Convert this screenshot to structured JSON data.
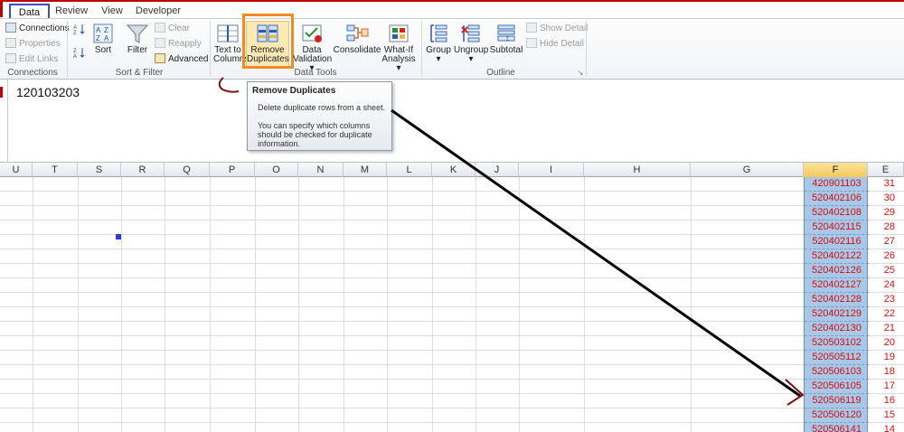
{
  "tabs": [
    {
      "label": "Data",
      "active": true
    },
    {
      "label": "Review",
      "active": false
    },
    {
      "label": "View",
      "active": false
    },
    {
      "label": "Developer",
      "active": false
    }
  ],
  "ribbon": {
    "connections": {
      "connections_label": "Connections",
      "properties_label": "Properties",
      "edit_links_label": "Edit Links",
      "group_label": "Connections"
    },
    "sort_filter": {
      "sort_label": "Sort",
      "filter_label": "Filter",
      "clear_label": "Clear",
      "reapply_label": "Reapply",
      "advanced_label": "Advanced",
      "group_label": "Sort & Filter"
    },
    "data_tools": {
      "text_to_columns_line1": "Text to",
      "text_to_columns_line2": "Columns",
      "remove_duplicates_line1": "Remove",
      "remove_duplicates_line2": "Duplicates",
      "data_validation_line1": "Data",
      "data_validation_line2": "Validation",
      "consolidate_label": "Consolidate",
      "whatif_line1": "What-If",
      "whatif_line2": "Analysis",
      "group_label": "Data Tools"
    },
    "outline": {
      "group_btn_label": "Group",
      "ungroup_label": "Ungroup",
      "subtotal_label": "Subtotal",
      "show_detail_label": "Show Detail",
      "hide_detail_label": "Hide Detail",
      "group_label": "Outline"
    }
  },
  "formula_bar": {
    "value": "120103203"
  },
  "tooltip": {
    "title": "Remove Duplicates",
    "description": "Delete duplicate rows from a sheet.",
    "detail": "You can specify which columns should be checked for duplicate information."
  },
  "column_headers": [
    "U",
    "T",
    "S",
    "R",
    "Q",
    "P",
    "O",
    "N",
    "M",
    "L",
    "K",
    "J",
    "I",
    "H",
    "G",
    "F",
    "E"
  ],
  "column_f_values": [
    "420901103",
    "520402106",
    "520402108",
    "520402115",
    "520402116",
    "520402122",
    "520402126",
    "520402127",
    "520402128",
    "520402129",
    "520402130",
    "520503102",
    "520505112",
    "520506103",
    "520506105",
    "520506119",
    "520506120",
    "520506141"
  ],
  "column_e_values": [
    "31",
    "30",
    "29",
    "28",
    "27",
    "26",
    "25",
    "24",
    "23",
    "22",
    "21",
    "20",
    "19",
    "18",
    "17",
    "16",
    "15",
    "14"
  ],
  "colors": {
    "active_tab_border": "#3a4fc4",
    "highlight_box": "#f08a24",
    "selection_fill": "#a9c8e8",
    "value_text": "#d01010",
    "annotation_stroke": "#8b1010"
  }
}
